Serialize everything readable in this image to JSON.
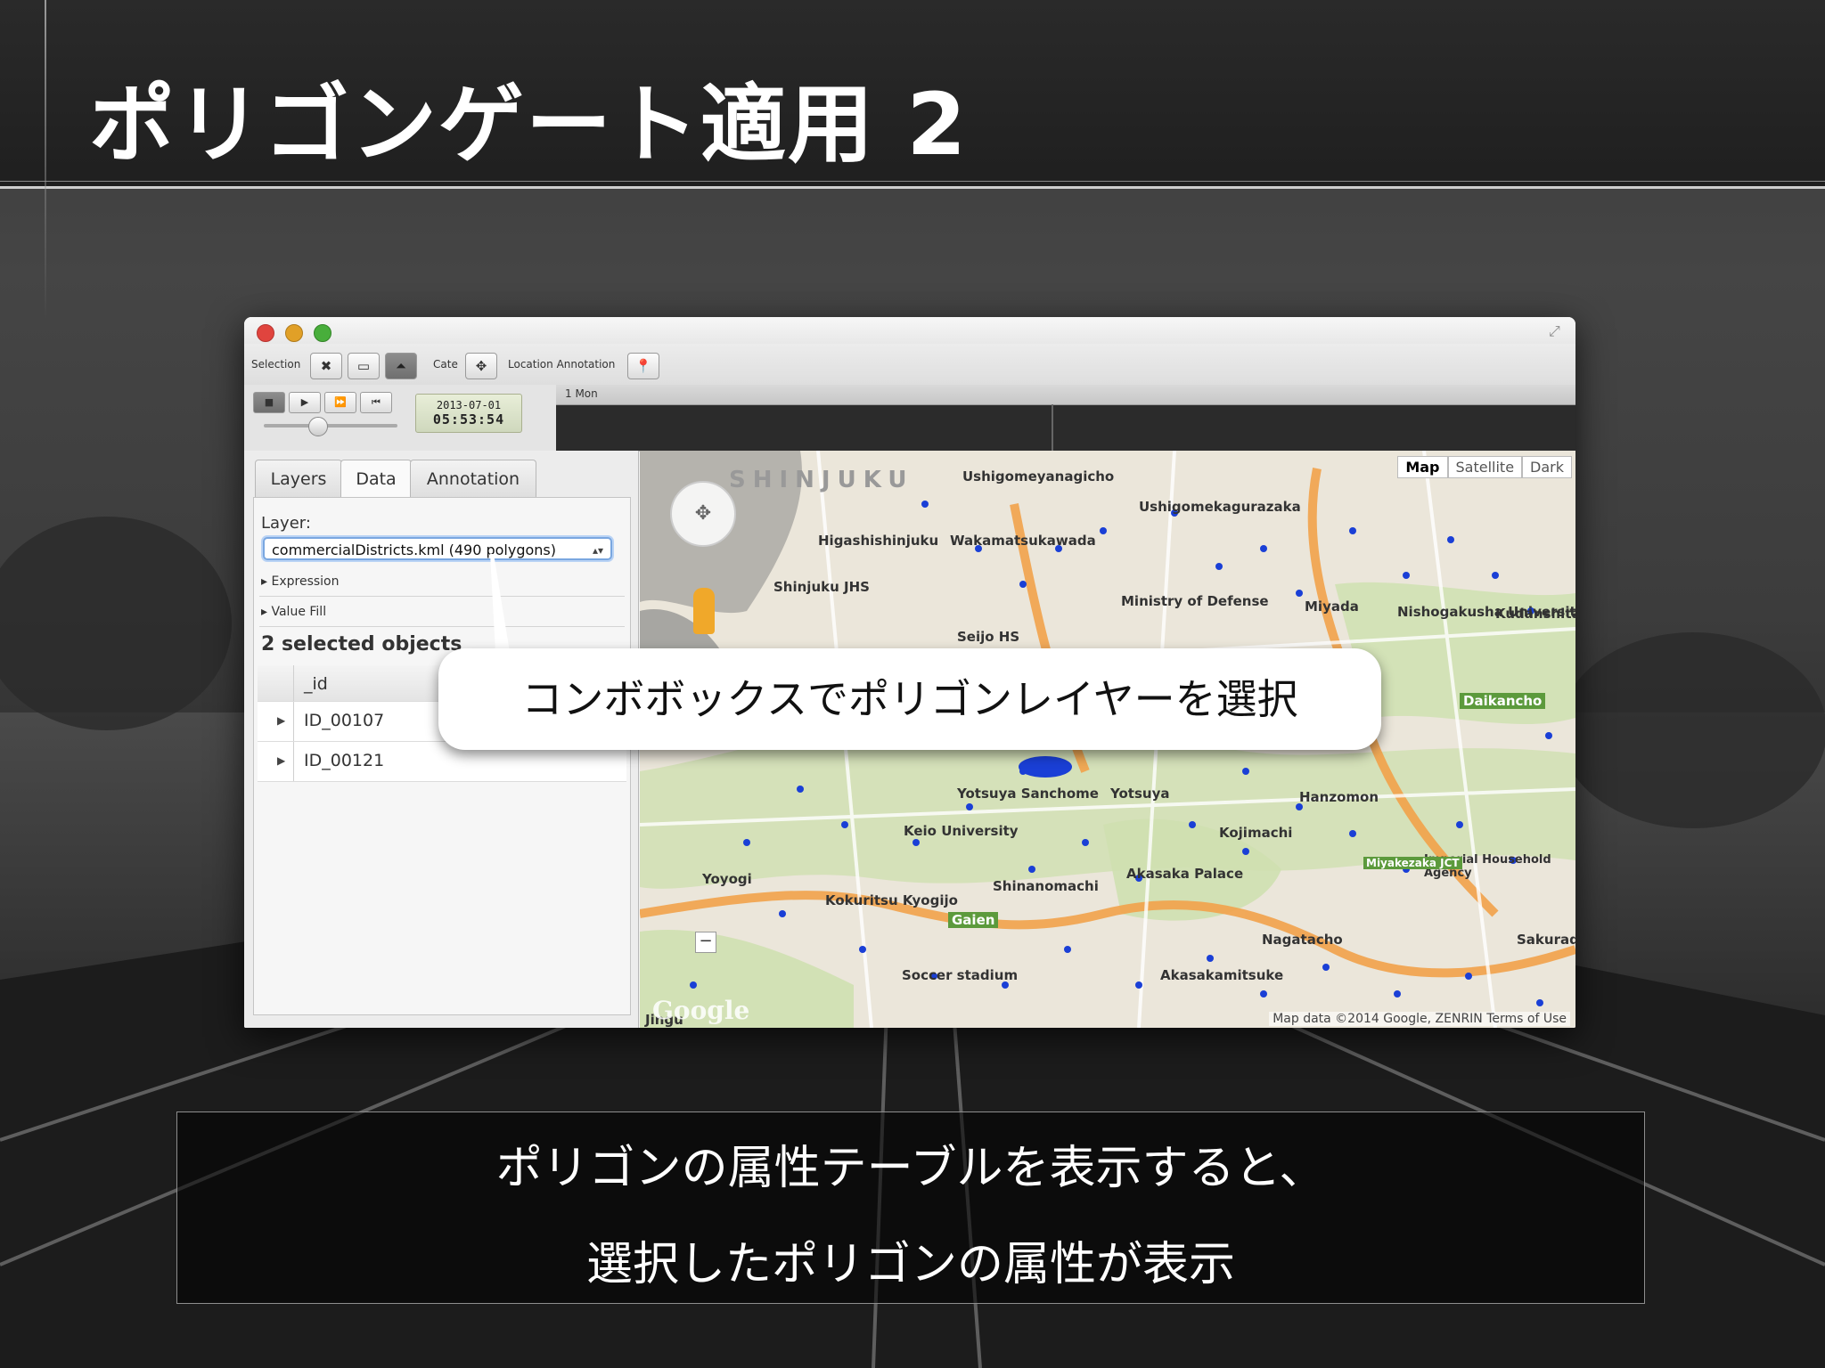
{
  "slide": {
    "title": "ポリゴンゲート適用 2",
    "callout": "コンボボックスでポリゴンレイヤーを選択",
    "caption_line1": "ポリゴンの属性テーブルを表示すると、",
    "caption_line2": "選択したポリゴンの属性が表示"
  },
  "toolbar": {
    "selection_label": "Selection",
    "cate_label": "Cate",
    "location_annotation_label": "Location Annotation"
  },
  "timeline": {
    "date": "2013-07-01",
    "time": "05:53:54",
    "ruler_label": "1 Mon"
  },
  "sidebar": {
    "tabs": [
      {
        "label": "Layers"
      },
      {
        "label": "Data"
      },
      {
        "label": "Annotation"
      }
    ],
    "active_tab": "Data",
    "layer_label": "Layer:",
    "layer_value": "commercialDistricts.kml (490 polygons)",
    "expression_label": "Expression",
    "value_fill_label": "Value Fill",
    "selected_objects": "2 selected objects",
    "table_header": "_id",
    "rows": [
      "ID_00107",
      "ID_00121"
    ]
  },
  "map": {
    "map_type_buttons": [
      "Map",
      "Satellite",
      "Dark"
    ],
    "selected_map_type": "Map",
    "attribution": "Map data ©2014 Google, ZENRIN   Terms of Use",
    "google_logo": "Google",
    "labels": [
      "SHINJUKU",
      "Ushigomeyanagicho",
      "Ushigomekagurazaka",
      "Higashishinjuku",
      "Wakamatsukawada",
      "Shinjuku JHS",
      "Ministry of Defense",
      "Miyada",
      "Nishogakusha University",
      "Kudanshita",
      "Daikancho",
      "Seijo HS",
      "Yotsuya Sanchome",
      "Yotsuya",
      "Hanzomon",
      "Kojimachi",
      "Keio University",
      "Akasaka Palace",
      "Shinanomachi",
      "Kokuritsu Kyogijo",
      "Gaien",
      "Nagatacho",
      "Akasakamitsuke",
      "Soccer stadium",
      "Imperial Household Agency",
      "Sakurada",
      "Miyakezaka JCT",
      "Yoyogi",
      "Jingu"
    ],
    "accent_color": "#1a3fd6"
  },
  "colors": {
    "window_bg": "#f2f2f2",
    "title_text": "#ffffff",
    "point_blue": "#1a3fd6"
  }
}
